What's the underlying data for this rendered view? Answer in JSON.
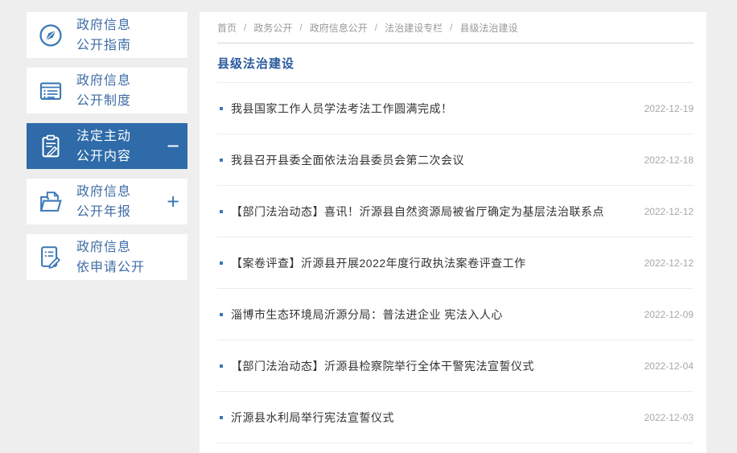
{
  "colors": {
    "page_background": "#eeeeee",
    "accent_blue": "#3b77b5",
    "active_item_background": "#2e6ba8",
    "title_blue": "#2a5a9e",
    "article_text": "#333333",
    "date_gray": "#a8a8a8",
    "breadcrumb_gray": "#999999"
  },
  "sidebar": {
    "items": [
      {
        "label_line1": "政府信息",
        "label_line2": "公开指南",
        "icon": "compass-icon",
        "active": false,
        "toggle": ""
      },
      {
        "label_line1": "政府信息",
        "label_line2": "公开制度",
        "icon": "document-list-icon",
        "active": false,
        "toggle": ""
      },
      {
        "label_line1": "法定主动",
        "label_line2": "公开内容",
        "icon": "clipboard-pencil-icon",
        "active": true,
        "toggle": "−"
      },
      {
        "label_line1": "政府信息",
        "label_line2": "公开年报",
        "icon": "folder-document-icon",
        "active": false,
        "toggle": "+"
      },
      {
        "label_line1": "政府信息",
        "label_line2": "依申请公开",
        "icon": "document-edit-icon",
        "active": false,
        "toggle": ""
      }
    ]
  },
  "breadcrumb": {
    "separator": "/",
    "items": [
      "首页",
      "政务公开",
      "政府信息公开",
      "法治建设专栏",
      "县级法治建设"
    ]
  },
  "main": {
    "title": "县级法治建设",
    "articles": [
      {
        "title": "我县国家工作人员学法考法工作圆满完成！",
        "date": "2022-12-19"
      },
      {
        "title": "我县召开县委全面依法治县委员会第二次会议",
        "date": "2022-12-18"
      },
      {
        "title": "【部门法治动态】喜讯！沂源县自然资源局被省厅确定为基层法治联系点",
        "date": "2022-12-12"
      },
      {
        "title": "【案卷评查】沂源县开展2022年度行政执法案卷评查工作",
        "date": "2022-12-12"
      },
      {
        "title": "淄博市生态环境局沂源分局：普法进企业 宪法入人心",
        "date": "2022-12-09"
      },
      {
        "title": "【部门法治动态】沂源县检察院举行全体干警宪法宣誓仪式",
        "date": "2022-12-04"
      },
      {
        "title": "沂源县水利局举行宪法宣誓仪式",
        "date": "2022-12-03"
      }
    ]
  }
}
